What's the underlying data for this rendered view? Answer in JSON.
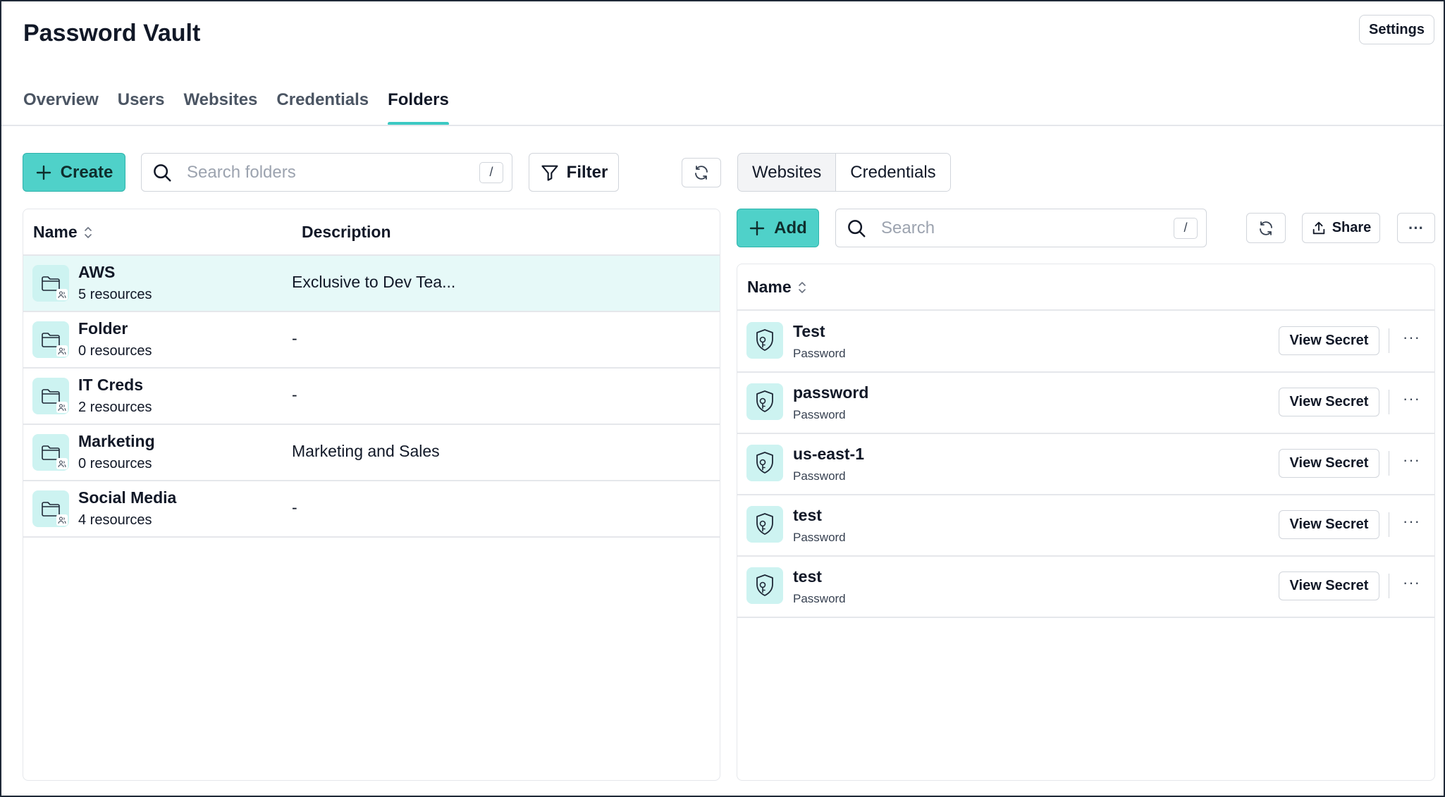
{
  "app": {
    "title": "Password Vault",
    "settings_label": "Settings"
  },
  "tabs": [
    {
      "label": "Overview",
      "active": false
    },
    {
      "label": "Users",
      "active": false
    },
    {
      "label": "Websites",
      "active": false
    },
    {
      "label": "Credentials",
      "active": false
    },
    {
      "label": "Folders",
      "active": true
    }
  ],
  "folders": {
    "create_label": "Create",
    "search_placeholder": "Search folders",
    "search_shortcut": "/",
    "filter_label": "Filter",
    "columns": {
      "name": "Name",
      "description": "Description"
    },
    "rows": [
      {
        "name": "AWS",
        "count": "5 resources",
        "description": "Exclusive to Dev Tea...",
        "selected": true
      },
      {
        "name": "Folder",
        "count": "0 resources",
        "description": "-",
        "selected": false
      },
      {
        "name": "IT Creds",
        "count": "2 resources",
        "description": "-",
        "selected": false
      },
      {
        "name": "Marketing",
        "count": "0 resources",
        "description": "Marketing and Sales",
        "selected": false
      },
      {
        "name": "Social Media",
        "count": "4 resources",
        "description": "-",
        "selected": false
      }
    ]
  },
  "detail": {
    "segments": [
      {
        "label": "Websites",
        "active": false
      },
      {
        "label": "Credentials",
        "active": true
      }
    ],
    "add_label": "Add",
    "search_placeholder": "Search",
    "search_shortcut": "/",
    "share_label": "Share",
    "more_label": "···",
    "columns": {
      "name": "Name"
    },
    "view_secret_label": "View Secret",
    "credentials": [
      {
        "name": "Test",
        "type": "Password"
      },
      {
        "name": "password",
        "type": "Password"
      },
      {
        "name": "us-east-1",
        "type": "Password"
      },
      {
        "name": "test",
        "type": "Password"
      },
      {
        "name": "test",
        "type": "Password"
      }
    ]
  },
  "colors": {
    "accent": "#4fd1c9",
    "selected_row": "#e6f9f8",
    "icon_bg": "#cdf3f1"
  }
}
